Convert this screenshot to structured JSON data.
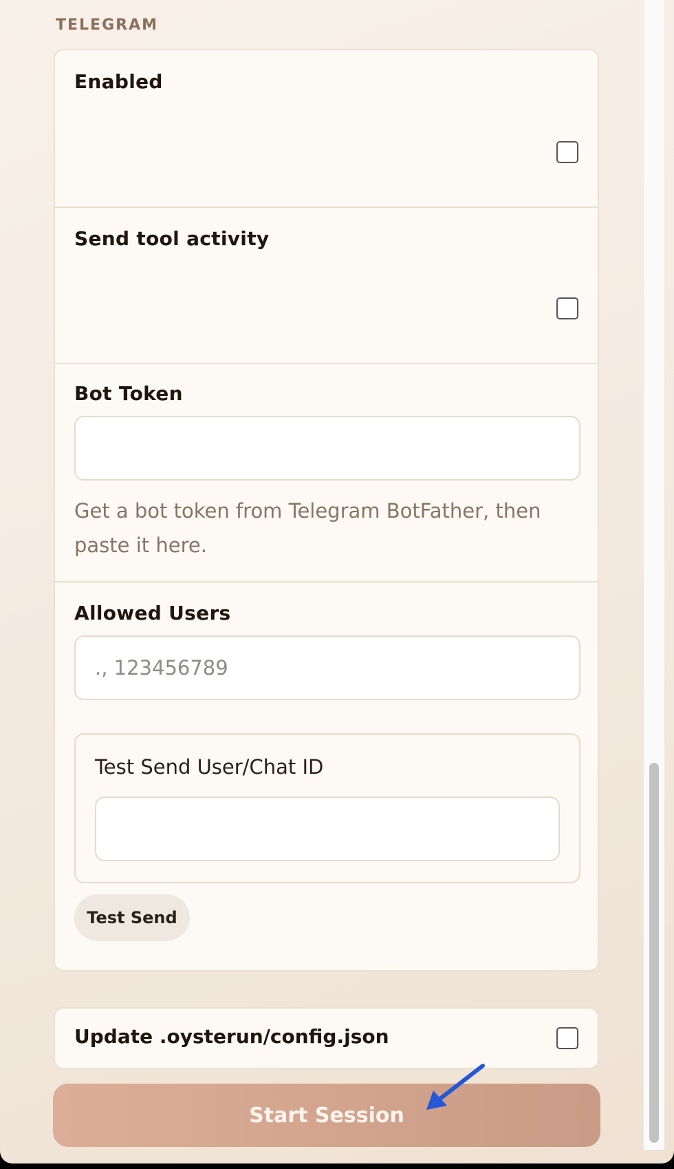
{
  "section": {
    "title": "TELEGRAM"
  },
  "telegram": {
    "enabled_label": "Enabled",
    "enabled_checked": false,
    "send_tool_activity_label": "Send tool activity",
    "send_tool_activity_checked": false,
    "bot_token": {
      "label": "Bot Token",
      "value": "",
      "help": "Get a bot token from Telegram BotFather, then paste it here."
    },
    "allowed_users": {
      "label": "Allowed Users",
      "placeholder": "., 123456789"
    },
    "test_send": {
      "label": "Test Send User/Chat ID",
      "value": "",
      "button_label": "Test Send"
    }
  },
  "update_config": {
    "label": "Update .oysterun/config.json",
    "checked": false
  },
  "start_button": {
    "label": "Start Session"
  },
  "colors": {
    "accent_button": "#d2a38d",
    "annotation_arrow": "#2458d6"
  }
}
